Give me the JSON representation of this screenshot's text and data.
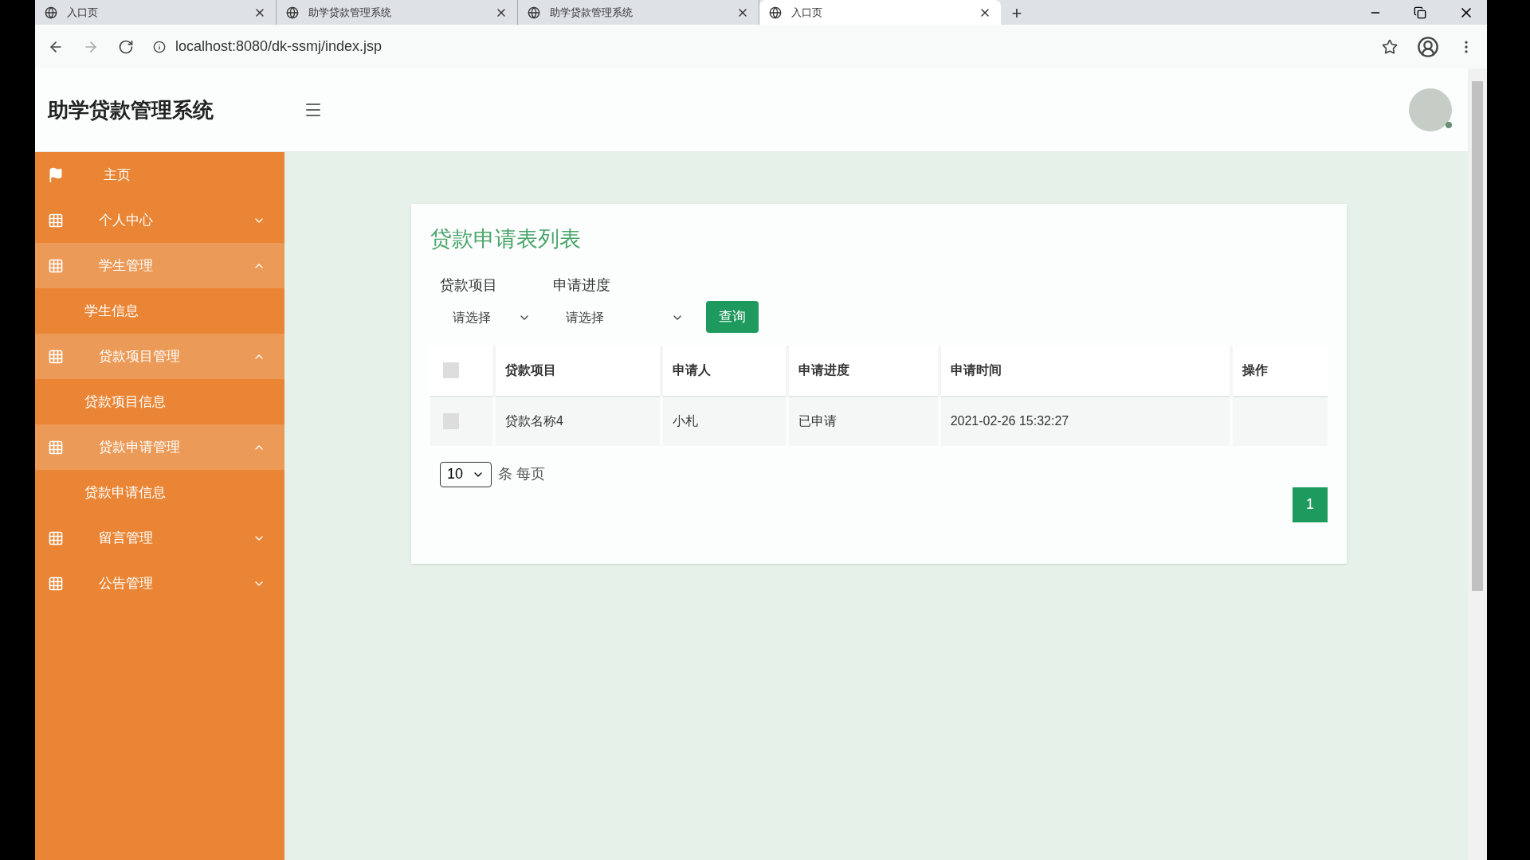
{
  "browser": {
    "tabs": [
      {
        "title": "入口页",
        "selected": false
      },
      {
        "title": "助学贷款管理系统",
        "selected": false
      },
      {
        "title": "助学贷款管理系统",
        "selected": false
      },
      {
        "title": "入口页",
        "selected": true
      }
    ],
    "new_tab": "+",
    "url": "localhost:8080/dk-ssmj/index.jsp"
  },
  "header": {
    "title": "助学贷款管理系统"
  },
  "sidebar": {
    "items": [
      {
        "kind": "home",
        "label": "主页"
      },
      {
        "kind": "group",
        "label": "个人中心",
        "expanded": false
      },
      {
        "kind": "group",
        "label": "学生管理",
        "expanded": true,
        "children": [
          {
            "label": "学生信息"
          }
        ]
      },
      {
        "kind": "group",
        "label": "贷款项目管理",
        "expanded": true,
        "children": [
          {
            "label": "贷款项目信息"
          }
        ]
      },
      {
        "kind": "group",
        "label": "贷款申请管理",
        "expanded": true,
        "children": [
          {
            "label": "贷款申请信息"
          }
        ]
      },
      {
        "kind": "group",
        "label": "留言管理",
        "expanded": false
      },
      {
        "kind": "group",
        "label": "公告管理",
        "expanded": false
      }
    ]
  },
  "card": {
    "title": "贷款申请表列表",
    "filters": [
      {
        "label": "贷款项目",
        "value": "请选择"
      },
      {
        "label": "申请进度",
        "value": "请选择"
      }
    ],
    "query_button": "查询",
    "table": {
      "select_all_checked": false,
      "columns": [
        "贷款项目",
        "申请人",
        "申请进度",
        "申请时间",
        "操作"
      ],
      "rows": [
        {
          "checked": false,
          "cells": [
            "贷款名称4",
            "小札",
            "已申请",
            "2021-02-26 15:32:27",
            ""
          ]
        }
      ]
    },
    "page_size": "10",
    "page_size_label": "条 每页",
    "pages": [
      {
        "label": "1",
        "selected": true
      }
    ]
  }
}
